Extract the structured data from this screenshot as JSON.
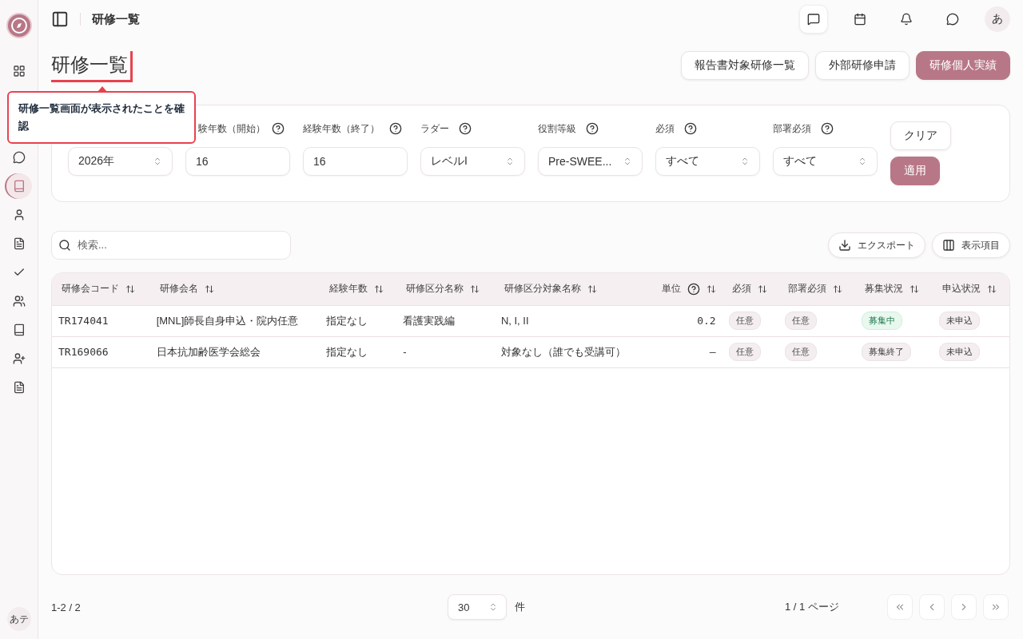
{
  "sidebar": {
    "items": [
      {
        "kind": "grid",
        "selected": false
      },
      {
        "kind": "chat",
        "selected": false
      },
      {
        "kind": "book",
        "selected": true
      },
      {
        "kind": "user",
        "selected": false
      },
      {
        "kind": "file",
        "selected": false
      },
      {
        "kind": "check",
        "selected": false
      },
      {
        "kind": "users",
        "selected": false
      },
      {
        "kind": "book",
        "selected": false
      },
      {
        "kind": "user-plus",
        "selected": false
      },
      {
        "kind": "file",
        "selected": false
      }
    ],
    "user_avatar": "あテ"
  },
  "header": {
    "title": "研修一覧",
    "actions": [
      {
        "kind": "message",
        "boxed": true
      },
      {
        "kind": "calendar",
        "boxed": false
      },
      {
        "kind": "bell",
        "boxed": false
      },
      {
        "kind": "chat",
        "boxed": false
      }
    ],
    "avatar": "あ"
  },
  "page": {
    "title": "研修一覧",
    "buttons": [
      {
        "label": "報告書対象研修一覧",
        "primary": false
      },
      {
        "label": "外部研修申請",
        "primary": false
      },
      {
        "label": "研修個人実績",
        "primary": true
      }
    ]
  },
  "annotation": {
    "text": "研修一覧画面が表示されたことを確認"
  },
  "filters": [
    {
      "kind": "select",
      "value": "2026年"
    },
    {
      "label": "験年数（開始）",
      "kind": "input",
      "value": "16"
    },
    {
      "label": "経験年数（終了）",
      "kind": "input",
      "value": "16"
    },
    {
      "label": "ラダー",
      "kind": "select",
      "value": "レベルI"
    },
    {
      "label": "役割等級",
      "kind": "select",
      "value": "Pre-SWEE..."
    },
    {
      "label": "必須",
      "kind": "select",
      "value": "すべて"
    },
    {
      "label": "部署必須",
      "kind": "select",
      "value": "すべて"
    }
  ],
  "filter_buttons": [
    {
      "label": "クリア",
      "primary": false
    },
    {
      "label": "適用",
      "primary": true
    }
  ],
  "search": {
    "placeholder": "検索..."
  },
  "toolbar": [
    {
      "label": "エクスポート",
      "kind": "download"
    },
    {
      "label": "表示項目",
      "kind": "columns"
    }
  ],
  "table": {
    "columns": [
      {
        "label": "研修会コード",
        "help": false
      },
      {
        "label": "研修会名",
        "help": false
      },
      {
        "label": "経験年数",
        "help": false
      },
      {
        "label": "研修区分名称",
        "help": false
      },
      {
        "label": "研修区分対象名称",
        "help": false
      },
      {
        "label": "単位",
        "help": true
      },
      {
        "label": "必須",
        "help": false
      },
      {
        "label": "部署必須",
        "help": false
      },
      {
        "label": "募集状況",
        "help": false
      },
      {
        "label": "申込状況",
        "help": false
      }
    ],
    "rows": [
      {
        "code": "TR174041",
        "name": "[MNL]師長自身申込・院内任意",
        "years": "指定なし",
        "category": "看護実践編",
        "target": "N, I, II",
        "units": "0.2",
        "required": "任意",
        "dept_required": "任意",
        "recruitment": {
          "text": "募集中",
          "open": true
        },
        "application": "未申込"
      },
      {
        "code": "TR169066",
        "name": "日本抗加齢医学会総会",
        "years": "指定なし",
        "category": "-",
        "target": "対象なし（誰でも受講可）",
        "units": "–",
        "required": "任意",
        "dept_required": "任意",
        "recruitment": {
          "text": "募集終了",
          "open": false
        },
        "application": "未申込"
      }
    ]
  },
  "footer": {
    "range": "1-2 / 2",
    "page_size": "30",
    "page_size_unit": "件",
    "page_info": "1 / 1 ページ"
  }
}
